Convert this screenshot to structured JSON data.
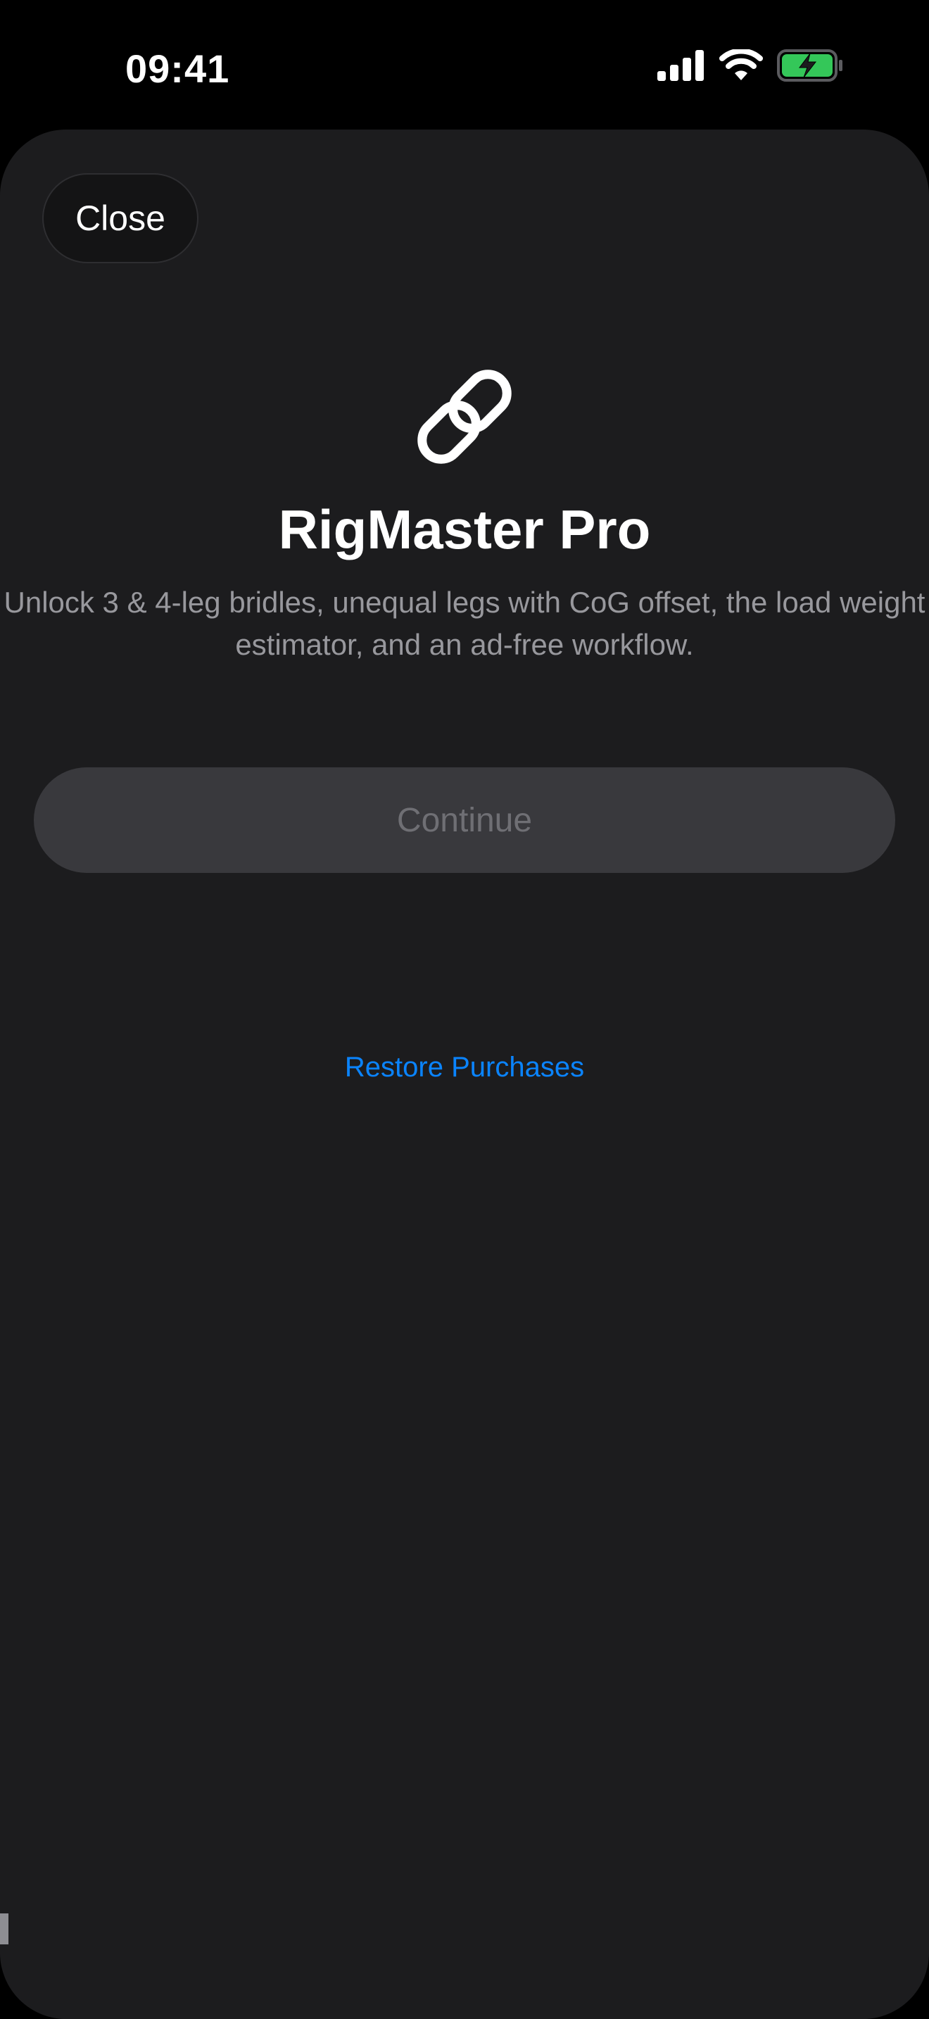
{
  "status_bar": {
    "time": "09:41",
    "signal_icon": "cellular-signal-icon",
    "wifi_icon": "wifi-icon",
    "battery_icon": "battery-charging-icon",
    "battery_color": "#34c759"
  },
  "sheet": {
    "close_label": "Close",
    "hero_icon": "link-icon",
    "title": "RigMaster Pro",
    "subtitle": "Unlock 3 & 4-leg bridles, unequal legs with CoG offset, the load weight estimator, and an ad-free workflow.",
    "continue_label": "Continue",
    "restore_label": "Restore Purchases"
  },
  "colors": {
    "background": "#000000",
    "sheet": "#1c1c1e",
    "accent": "#0a84ff",
    "secondary_text": "#98989d",
    "disabled_button": "#39393d"
  }
}
